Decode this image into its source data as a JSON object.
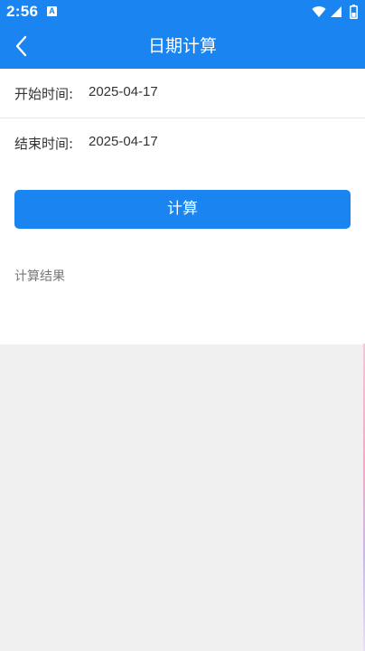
{
  "status_bar": {
    "time": "2:56",
    "notification_icon_letter": "A",
    "icons": [
      "wifi-icon",
      "signal-icon",
      "battery-icon"
    ]
  },
  "app_bar": {
    "title": "日期计算",
    "back_icon": "chevron-left-icon"
  },
  "form": {
    "start": {
      "label": "开始时间:",
      "value": "2025-04-17"
    },
    "end": {
      "label": "结束时间:",
      "value": "2025-04-17"
    },
    "calculate_label": "计算",
    "result_label": "计算结果"
  },
  "colors": {
    "primary": "#1a84f1",
    "background": "#f0f0f0",
    "card": "#ffffff",
    "text": "#333333",
    "muted_text": "#777777"
  }
}
